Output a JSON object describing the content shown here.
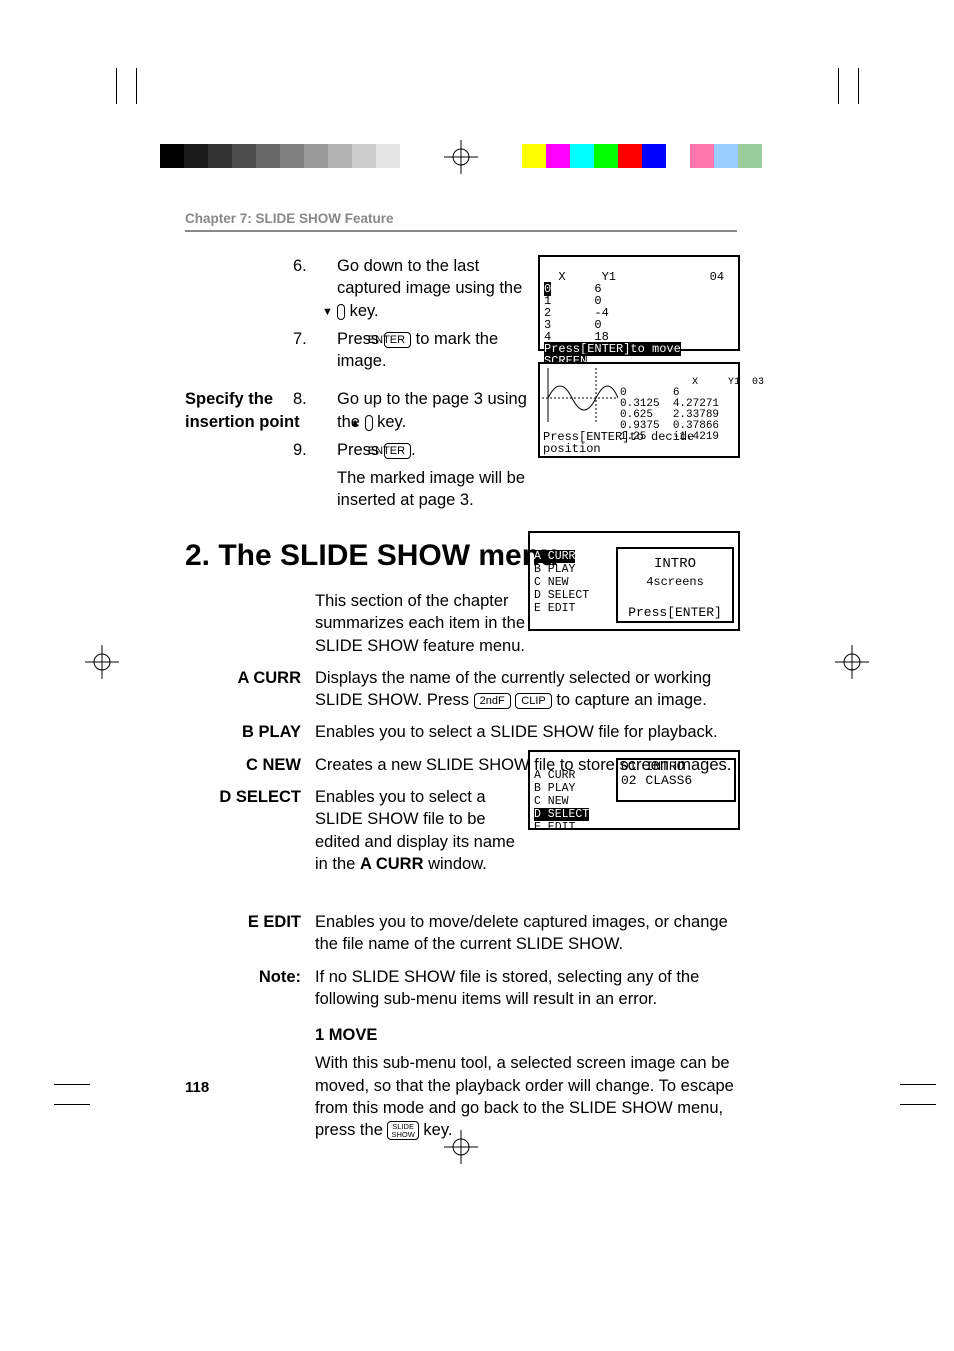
{
  "chapter_header": "Chapter 7: SLIDE SHOW Feature",
  "steps_a": {
    "s6": {
      "n": "6.",
      "pre": "Go down to the last captured image using the ",
      "post": " key."
    },
    "s7": {
      "n": "7.",
      "pre": "Press ",
      "key": "ENTER",
      "post": " to mark the image."
    }
  },
  "side_insertion": "Specify the insertion point",
  "steps_b": {
    "s8": {
      "n": "8.",
      "pre": "Go up to the page 3 using the ",
      "post": " key."
    },
    "s9": {
      "n": "9.",
      "pre": "Press ",
      "key": "ENTER",
      "post": ".",
      "after1": "The marked image will be inserted at page 3."
    }
  },
  "section_title": "2. The SLIDE SHOW menu",
  "intro": "This section of the chapter summarizes each item in the SLIDE SHOW feature menu.",
  "items": {
    "A": {
      "label": "A  CURR",
      "pre": "Displays the name of the currently selected or working SLIDE SHOW. Press ",
      "k1": "2ndF",
      "k2": "CLIP",
      "post": " to capture an image."
    },
    "B": {
      "label": "B  PLAY",
      "text": "Enables you to select a SLIDE SHOW file for playback."
    },
    "C": {
      "label": "C  NEW",
      "text": "Creates a new SLIDE SHOW file to store screen images."
    },
    "D": {
      "label": "D  SELECT",
      "pre": "Enables you to select a SLIDE SHOW file to be edited and display its name in the ",
      "bold": "A CURR",
      "post": " window."
    },
    "E": {
      "label": "E  EDIT",
      "text": "Enables you to move/delete captured images, or change the file name of the current SLIDE SHOW."
    },
    "Note": {
      "label": "Note:",
      "text": "If no SLIDE SHOW file is stored, selecting any of the following sub-menu items will result in an error."
    }
  },
  "move": {
    "heading": "1 MOVE",
    "body_pre": "With this sub-menu tool, a selected screen image can be moved, so that the playback order will change. To escape from this mode and go back to the SLIDE SHOW menu, press the ",
    "key_top": "SLIDE",
    "key_bot": "SHOW",
    "body_post": " key."
  },
  "fig1": {
    "header": "  X     Y1             04",
    "rows": [
      [
        "0",
        "6"
      ],
      [
        "1",
        "0"
      ],
      [
        "2",
        "-4"
      ],
      [
        "3",
        "0"
      ],
      [
        "4",
        "18"
      ]
    ],
    "footer1": "Press[ENTER]to move",
    "footer2": "SCREEN"
  },
  "fig2": {
    "header": "            X     Y1  03",
    "rows": [
      [
        "0",
        "6"
      ],
      [
        "0.3125",
        "4.27271"
      ],
      [
        "0.625",
        "2.33789"
      ],
      [
        "0.9375",
        "0.37866"
      ],
      [
        "1.25",
        "-1.4219"
      ]
    ],
    "footer1": "Press[ENTER]to decide",
    "footer2": "position"
  },
  "fig3": {
    "menu": [
      "A CURR",
      "B PLAY",
      "C NEW",
      "D SELECT",
      "E EDIT"
    ],
    "panel_line1": "INTRO",
    "panel_line2": "  4screens",
    "panel_line3": "Press[ENTER]"
  },
  "fig4": {
    "menu": [
      "A CURR",
      "B PLAY",
      "C NEW",
      "D SELECT",
      "E EDIT"
    ],
    "panel_line1": "01 INTRO",
    "panel_line2": "02 CLASS6"
  },
  "page_number": "118"
}
